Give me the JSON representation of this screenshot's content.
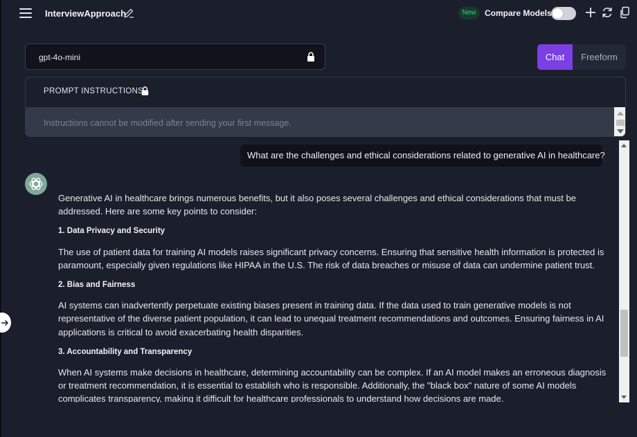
{
  "header": {
    "title": "InterviewApproach",
    "new_badge": "New",
    "compare_label": "Compare Models",
    "compare_enabled": false
  },
  "model_selector": {
    "value": "gpt-4o-mini"
  },
  "mode_tabs": {
    "active": "Chat",
    "chat_label": "Chat",
    "freeform_label": "Freeform"
  },
  "prompt_instructions": {
    "header": "PROMPT INSTRUCTIONS",
    "placeholder": "Instructions cannot be modified after sending your first message."
  },
  "chat": {
    "user_message": "What are the challenges and ethical considerations related to generative AI in healthcare?",
    "assistant": {
      "intro": "Generative AI in healthcare brings numerous benefits, but it also poses several challenges and ethical considerations that must be addressed. Here are some key points to consider:",
      "sections": [
        {
          "heading": "1. Data Privacy and Security",
          "body": "The use of patient data for training AI models raises significant privacy concerns. Ensuring that sensitive health information is protected is paramount, especially given regulations like HIPAA in the U.S. The risk of data breaches or misuse of data can undermine patient trust."
        },
        {
          "heading": "2. Bias and Fairness",
          "body": "AI systems can inadvertently perpetuate existing biases present in training data. If the data used to train generative models is not representative of the diverse patient population, it can lead to unequal treatment recommendations and outcomes. Ensuring fairness in AI applications is critical to avoid exacerbating health disparities."
        },
        {
          "heading": "3. Accountability and Transparency",
          "body": "When AI systems make decisions in healthcare, determining accountability can be complex. If an AI model makes an erroneous diagnosis or treatment recommendation, it is essential to establish who is responsible. Additionally, the \"black box\" nature of some AI models complicates transparency, making it difficult for healthcare professionals to understand how decisions are made."
        }
      ]
    }
  },
  "colors": {
    "background": "#1b1f2b",
    "accent": "#7b3fe4",
    "new_badge_text": "#41c98b"
  },
  "icons": [
    "menu-icon",
    "edit-icon",
    "plus-icon",
    "refresh-icon",
    "copy-icon",
    "lock-icon",
    "openai-logo-icon",
    "arrow-right-icon"
  ]
}
